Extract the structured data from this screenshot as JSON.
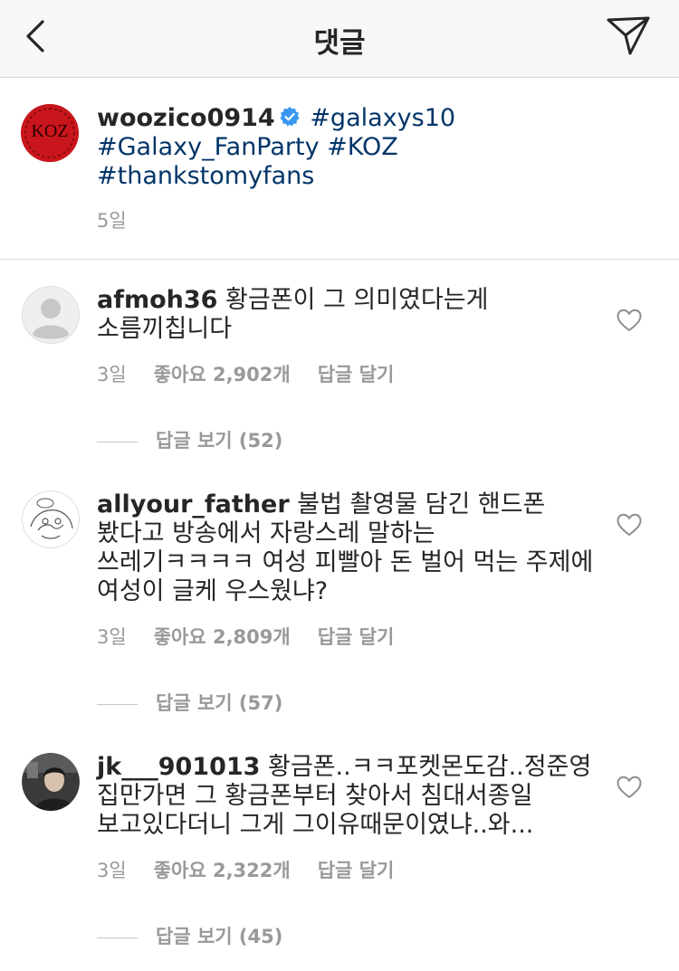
{
  "header": {
    "title": "댓글",
    "back_icon": "chevron-left-icon",
    "share_icon": "paper-plane-icon"
  },
  "caption": {
    "avatar_text": "KOZ",
    "username": "woozico0914",
    "verified": true,
    "text_line1": "#galaxys10",
    "text_line2": "#Galaxy_FanParty #KOZ",
    "text_line3": "#thankstomyfans",
    "time": "5일"
  },
  "comments": [
    {
      "username": "afmoh36",
      "line1": "황금폰이 그 의미였다는게",
      "line2": "소름끼칩니다",
      "line3": "",
      "line4": "",
      "time": "3일",
      "likes": "좋아요 2,902개",
      "reply": "답글 달기",
      "view_replies": "답글 보기 (52)"
    },
    {
      "username": "allyour_father",
      "line1": "불법 촬영물 담긴 핸드폰",
      "line2": "봤다고 방송에서 자랑스레 말하는",
      "line3": "쓰레기ㅋㅋㅋㅋ 여성 피빨아 돈 벌어 먹는 주제에",
      "line4": "여성이 글케 우스웠냐?",
      "time": "3일",
      "likes": "좋아요 2,809개",
      "reply": "답글 달기",
      "view_replies": "답글 보기 (57)"
    },
    {
      "username": "jk___901013",
      "line1": "황금폰..ㅋㅋ포켓몬도감..정준영",
      "line2": "집만가면 그 황금폰부터 찾아서 침대서종일",
      "line3": "보고있다더니 그게 그이유때문이였냐..와...",
      "line4": "",
      "time": "3일",
      "likes": "좋아요 2,322개",
      "reply": "답글 달기",
      "view_replies": "답글 보기 (45)"
    }
  ],
  "colors": {
    "header_bg": "#f7f7f7",
    "hashtag": "#003569",
    "secondary_text": "#999999",
    "verified_badge": "#3897f0",
    "avatar_red": "#c8161c"
  }
}
